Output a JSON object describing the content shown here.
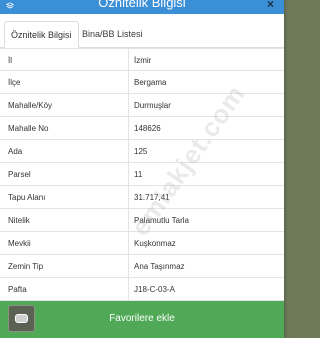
{
  "header": {
    "title": "Öznitelik Bilgisi",
    "close_glyph": "×",
    "icon": "layers-icon"
  },
  "tabs": [
    {
      "label": "Öznitelik Bilgisi",
      "active": true
    },
    {
      "label": "Bina/BB Listesi",
      "active": false
    }
  ],
  "attributes": [
    {
      "key": "İl",
      "value": "İzmir"
    },
    {
      "key": "İlçe",
      "value": "Bergama"
    },
    {
      "key": "Mahalle/Köy",
      "value": "Durmuşlar"
    },
    {
      "key": "Mahalle No",
      "value": "148626"
    },
    {
      "key": "Ada",
      "value": "125"
    },
    {
      "key": "Parsel",
      "value": "11"
    },
    {
      "key": "Tapu Alanı",
      "value": "31.717,41"
    },
    {
      "key": "Nitelik",
      "value": "Palamutlu Tarla"
    },
    {
      "key": "Mevkii",
      "value": "Kuşkonmaz"
    },
    {
      "key": "Zemin Tip",
      "value": "Ana Taşınmaz"
    },
    {
      "key": "Pafta",
      "value": "J18-C-03-A"
    }
  ],
  "watermark": "emlakjet.com",
  "footer": {
    "favorite_label": "Favorilere ekle"
  },
  "colors": {
    "header": "#3b8fd6",
    "footer": "#4fa957",
    "border": "#e4e4e4"
  }
}
